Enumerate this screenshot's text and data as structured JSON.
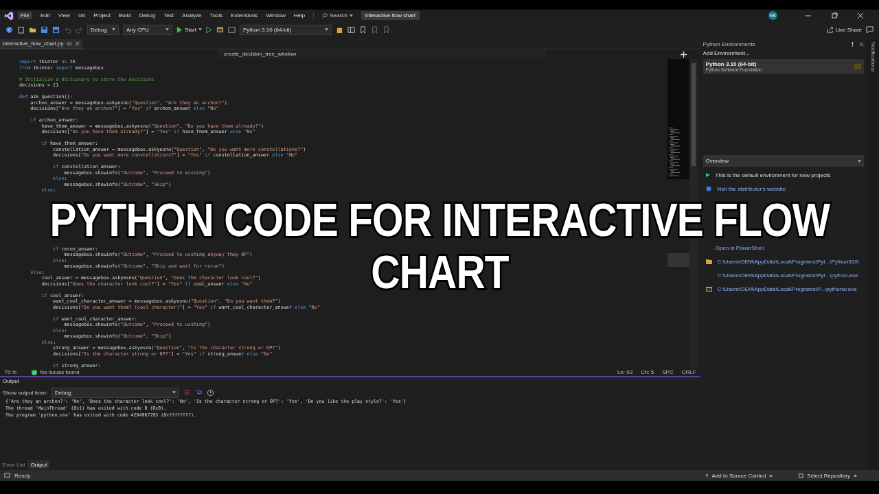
{
  "menu_bar": {
    "items": [
      {
        "label": "File",
        "selected": true
      },
      {
        "label": "Edit",
        "selected": false
      },
      {
        "label": "View",
        "selected": false
      },
      {
        "label": "Git",
        "selected": false
      },
      {
        "label": "Project",
        "selected": false
      },
      {
        "label": "Build",
        "selected": false
      },
      {
        "label": "Debug",
        "selected": false
      },
      {
        "label": "Test",
        "selected": false
      },
      {
        "label": "Analyze",
        "selected": false
      },
      {
        "label": "Tools",
        "selected": false
      },
      {
        "label": "Extensions",
        "selected": false
      },
      {
        "label": "Window",
        "selected": false
      },
      {
        "label": "Help",
        "selected": false
      }
    ],
    "search": "Search",
    "solution_title": "Interactive flow chart",
    "avatar": "SK"
  },
  "toolbar": {
    "configuration": "Debug",
    "platform": "Any CPU",
    "start": "Start",
    "environment": "Python 3.10 (64-bit)",
    "live_share": "Live Share"
  },
  "editor": {
    "tab": {
      "label": "Interactive_flow_chart.py",
      "selected": true
    },
    "navigation": "create_decision_tree_window",
    "code_top": [
      {
        "text": "import tkinter as tk",
        "blank_before": false
      },
      {
        "text": "from tkinter import messagebox",
        "blank_before": false
      },
      {
        "text": "# Initialize a dictionary to store the decisions",
        "blank_before": true
      },
      {
        "text": "decisions = {}",
        "blank_before": false
      },
      {
        "text": "def ask_question():",
        "blank_before": true
      },
      {
        "text": "    archon_answer = messagebox.askyesno(\"Question\", \"Are they an archon?\")",
        "blank_before": false
      },
      {
        "text": "    decisions[\"Are they an archon?\"] = \"Yes\" if archon_answer else \"No\"",
        "blank_before": false
      },
      {
        "text": "    if archon_answer:",
        "blank_before": true
      },
      {
        "text": "        have_them_answer = messagebox.askyesno(\"Question\", \"Do you have them already?\")",
        "blank_before": false
      },
      {
        "text": "        decisions[\"Do you have them already?\"] = \"Yes\" if have_them_answer else \"No\"",
        "blank_before": false
      },
      {
        "text": "        if have_them_answer:",
        "blank_before": true
      },
      {
        "text": "            constellation_answer = messagebox.askyesno(\"Question\", \"Do you want more constellations?\")",
        "blank_before": false
      },
      {
        "text": "            decisions[\"Do you want more constellations?\"] = \"Yes\" if constellation_answer else \"No\"",
        "blank_before": false
      },
      {
        "text": "            if constellation_answer:",
        "blank_before": true
      },
      {
        "text": "                messagebox.showinfo(\"Outcome\", \"Proceed to wishing\")",
        "blank_before": false
      },
      {
        "text": "            else:",
        "blank_before": false
      },
      {
        "text": "                messagebox.showinfo(\"Outcome\", \"Skip\")",
        "blank_before": false
      },
      {
        "text": "        else:",
        "blank_before": false
      }
    ],
    "code_bottom": [
      {
        "text": "            if rerun_answer:",
        "blank_before": false
      },
      {
        "text": "                messagebox.showinfo(\"Outcome\", \"Proceed to wishing anyway they OP\")",
        "blank_before": false
      },
      {
        "text": "            else:",
        "blank_before": false
      },
      {
        "text": "                messagebox.showinfo(\"Outcome\", \"Skip and wait for rerun\")",
        "blank_before": false
      },
      {
        "text": "    else:",
        "blank_before": false
      },
      {
        "text": "        cool_answer = messagebox.askyesno(\"Question\", \"Does the character look cool?\")",
        "blank_before": false
      },
      {
        "text": "        decisions[\"Does the character look cool?\"] = \"Yes\" if cool_answer else \"No\"",
        "blank_before": false
      },
      {
        "text": "        if cool_answer:",
        "blank_before": true
      },
      {
        "text": "            want_cool_character_answer = messagebox.askyesno(\"Question\", \"Do you want them?\")",
        "blank_before": false
      },
      {
        "text": "            decisions[\"Do you want them? (cool character)\"] = \"Yes\" if want_cool_character_answer else \"No\"",
        "blank_before": false
      },
      {
        "text": "            if want_cool_character_answer:",
        "blank_before": true
      },
      {
        "text": "                messagebox.showinfo(\"Outcome\", \"Proceed to wishing\")",
        "blank_before": false
      },
      {
        "text": "            else:",
        "blank_before": false
      },
      {
        "text": "                messagebox.showinfo(\"Outcome\", \"Skip\")",
        "blank_before": false
      },
      {
        "text": "        else:",
        "blank_before": false
      },
      {
        "text": "            strong_answer = messagebox.askyesno(\"Question\", \"Is the character strong or OP?\")",
        "blank_before": false
      },
      {
        "text": "            decisions[\"Is the character strong or OP?\"] = \"Yes\" if strong_answer else \"No\"",
        "blank_before": false
      },
      {
        "text": "            if strong_answer:",
        "blank_before": true
      }
    ],
    "status": {
      "zoom": "75 %",
      "issues": "No issues found",
      "line": "Ln: 93",
      "column": "Ch: 5",
      "whitespace": "SPC",
      "line_ending": "CRLF"
    }
  },
  "python_environments": {
    "title": "Python Environments",
    "add": "Add Environment...",
    "environment": {
      "name": "Python 3.10 (64-bit)",
      "vendor": "Python Software Foundation"
    },
    "section": "Overview",
    "default_note": "This is the default environment for new projects",
    "website_link": "Visit the distributor's website",
    "powershell_link": "Open in PowerShell",
    "paths": [
      {
        "kind": "folder",
        "text": "C:\\Users\\OEM\\AppData\\Local\\Programs\\Pyt...\\Python310\\"
      },
      {
        "kind": "exe",
        "text": "C:\\Users\\OEM\\AppData\\Local\\Programs\\Pyt...\\python.exe"
      },
      {
        "kind": "window",
        "text": "C:\\Users\\OEM\\AppData\\Local\\Programs\\P...\\pythonw.exe"
      }
    ]
  },
  "notifications_label": "Notifications",
  "output": {
    "title": "Output",
    "source_label": "Show output from:",
    "source": "Debug",
    "lines": [
      "{'Are they an archon?': 'No', 'Does the character look cool?': 'No', 'Is the character strong or OP?': 'Yes', 'Do you like the play style?': 'Yes'}",
      "The thread 'MainThread' (0x1) has exited with code 0 (0x0).",
      "The program 'python.exe' has exited with code 4294967295 (0xffffffff)."
    ],
    "tabs": [
      {
        "label": "Error List",
        "selected": false
      },
      {
        "label": "Output",
        "selected": true
      }
    ]
  },
  "status_bar": {
    "state": "Ready",
    "source_control": "Add to Source Control",
    "repository": "Select Repository"
  },
  "overlay_title": [
    "PYTHON CODE FOR INTERACTIVE FLOW",
    "CHART"
  ]
}
